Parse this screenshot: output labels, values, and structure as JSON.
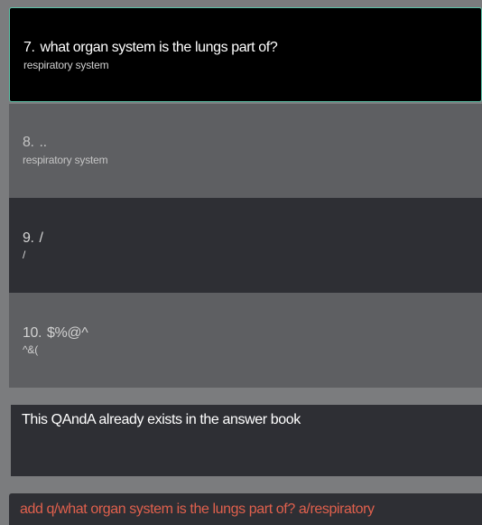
{
  "qanda_list": {
    "items": [
      {
        "index": "7.",
        "question": "what organ system is the lungs part of?",
        "answer": "respiratory system",
        "state": "selected"
      },
      {
        "index": "8.",
        "question": "..",
        "answer": "respiratory system",
        "state": "normal"
      },
      {
        "index": "9.",
        "question": "/",
        "answer": "/",
        "state": "normal"
      },
      {
        "index": "10.",
        "question": "$%@^",
        "answer": "^&(",
        "state": "normal"
      }
    ]
  },
  "result_display": {
    "message": "This QAndA already exists in the answer book"
  },
  "command_box": {
    "value": "add q/what organ system is the lungs part of? a/respiratory"
  },
  "colors": {
    "window_background": "#7b7c7e",
    "selected_card_background": "#000000",
    "selected_card_border": "#5fc3a9",
    "card_light": "#5e5f62",
    "card_dark": "#2e2f34",
    "command_error_text": "#e0604d"
  }
}
